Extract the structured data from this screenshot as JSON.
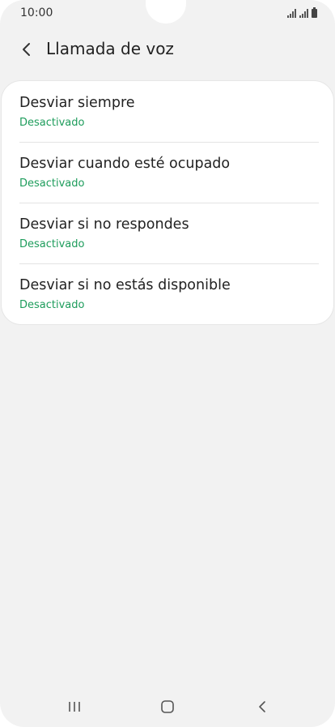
{
  "status_bar": {
    "time": "10:00"
  },
  "header": {
    "title": "Llamada de voz",
    "back_icon": "chevron-left-icon"
  },
  "settings": [
    {
      "title": "Desviar siempre",
      "status": "Desactivado"
    },
    {
      "title": "Desviar cuando esté ocupado",
      "status": "Desactivado"
    },
    {
      "title": "Desviar si no respondes",
      "status": "Desactivado"
    },
    {
      "title": "Desviar si no estás disponible",
      "status": "Desactivado"
    }
  ],
  "nav_bar": {
    "recents_icon": "recents-icon",
    "home_icon": "home-icon",
    "back_icon": "back-icon"
  },
  "colors": {
    "background": "#f2f2f2",
    "card": "#ffffff",
    "status_text": "#1d9c5b",
    "primary_text": "#222222"
  }
}
